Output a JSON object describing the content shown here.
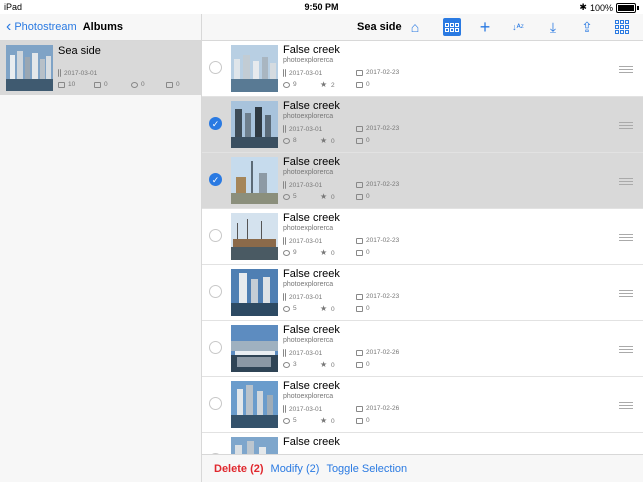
{
  "status": {
    "device": "iPad",
    "time": "9:50 PM",
    "battery": "100%"
  },
  "sidebar": {
    "back_label": "Photostream",
    "title": "Albums",
    "album": {
      "name": "Sea side",
      "date": "2017-03-01",
      "photos": "10",
      "videos": "0",
      "views": "0",
      "comments": "0"
    }
  },
  "toolbar": {
    "title": "Sea side"
  },
  "rows": [
    {
      "title": "False creek",
      "author": "photoexplorerca",
      "uploaded": "2017-03-01",
      "taken": "2017-02-23",
      "views": "9",
      "favs": "2",
      "comments": "0",
      "selected": false
    },
    {
      "title": "False creek",
      "author": "photoexplorerca",
      "uploaded": "2017-03-01",
      "taken": "2017-02-23",
      "views": "8",
      "favs": "0",
      "comments": "0",
      "selected": true
    },
    {
      "title": "False creek",
      "author": "photoexplorerca",
      "uploaded": "2017-03-01",
      "taken": "2017-02-23",
      "views": "5",
      "favs": "0",
      "comments": "0",
      "selected": true
    },
    {
      "title": "False creek",
      "author": "photoexplorerca",
      "uploaded": "2017-03-01",
      "taken": "2017-02-23",
      "views": "9",
      "favs": "0",
      "comments": "0",
      "selected": false
    },
    {
      "title": "False creek",
      "author": "photoexplorerca",
      "uploaded": "2017-03-01",
      "taken": "2017-02-23",
      "views": "5",
      "favs": "0",
      "comments": "0",
      "selected": false
    },
    {
      "title": "False creek",
      "author": "photoexplorerca",
      "uploaded": "2017-03-01",
      "taken": "2017-02-26",
      "views": "3",
      "favs": "0",
      "comments": "0",
      "selected": false
    },
    {
      "title": "False creek",
      "author": "photoexplorerca",
      "uploaded": "2017-03-01",
      "taken": "2017-02-26",
      "views": "5",
      "favs": "0",
      "comments": "0",
      "selected": false
    },
    {
      "title": "False creek",
      "author": "",
      "uploaded": "",
      "taken": "",
      "views": "",
      "favs": "",
      "comments": "",
      "selected": false
    }
  ],
  "bottombar": {
    "delete_label": "Delete (2)",
    "modify_label": "Modify (2)",
    "toggle_label": "Toggle Selection"
  },
  "colors": {
    "accent": "#2a7ae2",
    "destructive": "#e0282e",
    "selected_row": "#d9d9d9"
  },
  "icons": {
    "back": "chevron-left-icon",
    "home": "home-icon",
    "view": "gallery-view-icon",
    "add": "plus-icon",
    "sort": "sort-az-icon",
    "download": "download-icon",
    "share": "share-icon",
    "grid": "grid-icon"
  }
}
